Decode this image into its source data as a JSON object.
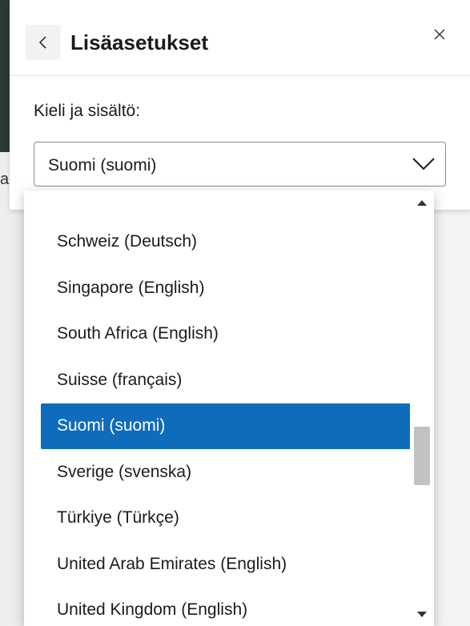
{
  "panel": {
    "title": "Lisäasetukset",
    "back_icon": "chevron-left-icon",
    "close_icon": "close-icon"
  },
  "language_field": {
    "label": "Kieli ja sisältö:",
    "selected_value": "Suomi (suomi)"
  },
  "background": {
    "partial_letter": "a"
  },
  "dropdown": {
    "options": [
      "",
      "Schweiz (Deutsch)",
      "Singapore (English)",
      "South Africa (English)",
      "Suisse (français)",
      "Suomi (suomi)",
      "Sverige (svenska)",
      "Türkiye (Türkçe)",
      "United Arab Emirates (English)",
      "United Kingdom (English)"
    ],
    "selected_index": 5
  },
  "colors": {
    "selected_bg": "#0f6cbd",
    "selected_text": "#ffffff"
  }
}
